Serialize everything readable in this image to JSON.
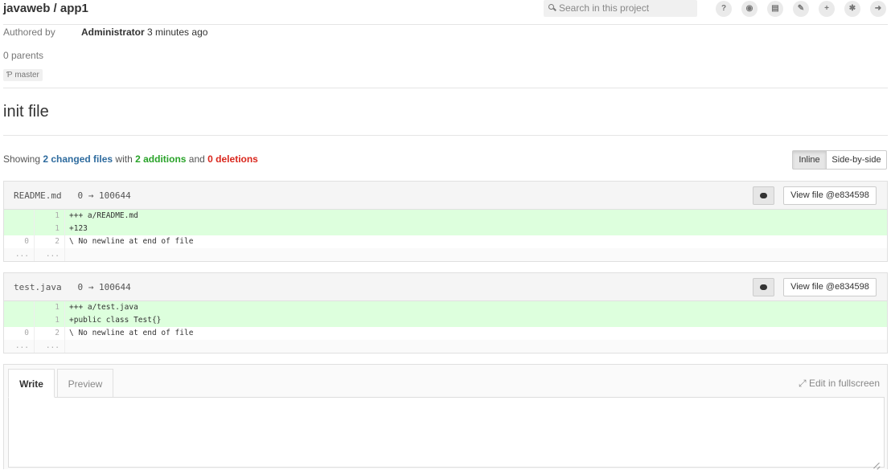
{
  "header": {
    "title": "javaweb / app1",
    "search_placeholder": "Search in this project",
    "toolbar_icons": [
      "question-icon",
      "globe-icon",
      "copy-icon",
      "wrench-icon",
      "plus-icon",
      "gear-icon",
      "logout-icon"
    ]
  },
  "commit": {
    "authored_label": "Authored by",
    "author": "Administrator",
    "time": "3 minutes ago",
    "parents": "0 parents",
    "branch": "master",
    "title": "init file"
  },
  "stats": {
    "prefix": "Showing",
    "changed": "2 changed files",
    "with": "with",
    "additions": "2 additions",
    "and": "and",
    "deletions": "0 deletions"
  },
  "view_toggle": {
    "inline": "Inline",
    "side": "Side-by-side",
    "active": "Inline"
  },
  "files": [
    {
      "name": "README.md",
      "mode": "0 → 100644",
      "view_button": "View file @e834598",
      "lines": [
        {
          "type": "add",
          "old": "",
          "new": "1",
          "code": "+++ a/README.md"
        },
        {
          "type": "add",
          "old": "",
          "new": "1",
          "code": "+123"
        },
        {
          "type": "ctx",
          "old": "0",
          "new": "2",
          "code": "\\ No newline at end of file"
        },
        {
          "type": "gap",
          "old": "...",
          "new": "...",
          "code": ""
        }
      ]
    },
    {
      "name": "test.java",
      "mode": "0 → 100644",
      "view_button": "View file @e834598",
      "lines": [
        {
          "type": "add",
          "old": "",
          "new": "1",
          "code": "+++ a/test.java"
        },
        {
          "type": "add",
          "old": "",
          "new": "1",
          "code": "+public class Test{}"
        },
        {
          "type": "ctx",
          "old": "0",
          "new": "2",
          "code": "\\ No newline at end of file"
        },
        {
          "type": "gap",
          "old": "...",
          "new": "...",
          "code": ""
        }
      ]
    }
  ],
  "editor": {
    "write_tab": "Write",
    "preview_tab": "Preview",
    "fullscreen": "Edit in fullscreen",
    "value": ""
  },
  "colors": {
    "addition_bg": "#ddffdd",
    "link_blue": "#2e6b9e",
    "addition_green": "#29a329",
    "deletion_red": "#d9261c"
  }
}
